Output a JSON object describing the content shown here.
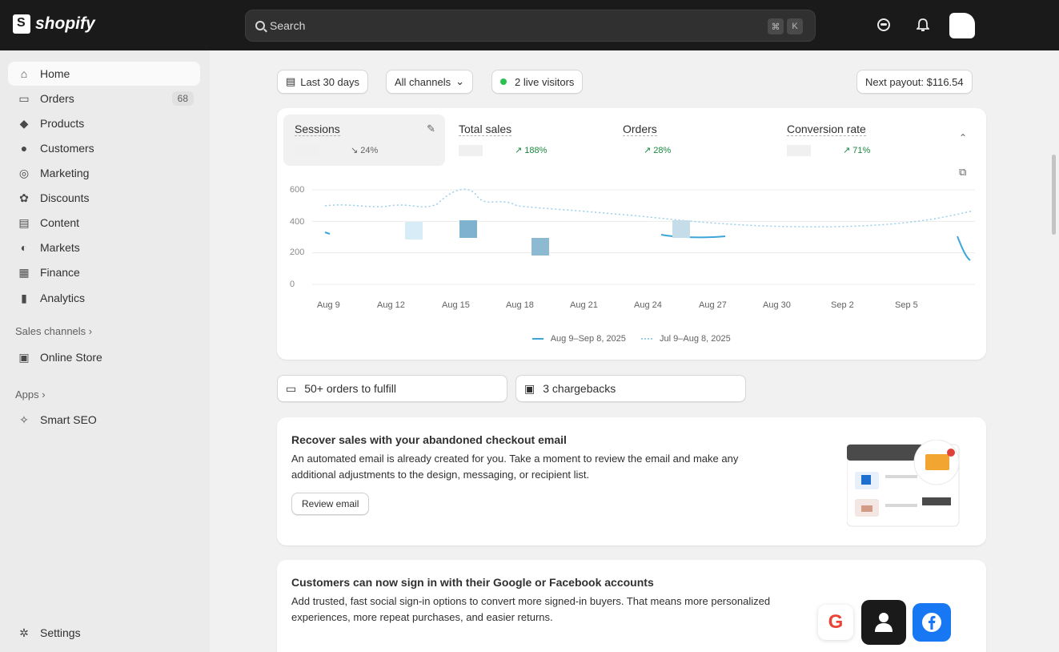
{
  "topbar": {
    "logo_text": "shopify",
    "search_placeholder": "Search",
    "shortcut_key1": "⌘",
    "shortcut_key2": "K"
  },
  "sidebar": {
    "items": [
      {
        "label": "Home",
        "icon": "home-icon"
      },
      {
        "label": "Orders",
        "icon": "inbox-icon",
        "badge": "68"
      },
      {
        "label": "Products",
        "icon": "tag-icon"
      },
      {
        "label": "Customers",
        "icon": "person-icon"
      },
      {
        "label": "Marketing",
        "icon": "target-icon"
      },
      {
        "label": "Discounts",
        "icon": "discount-icon"
      },
      {
        "label": "Content",
        "icon": "content-icon"
      },
      {
        "label": "Markets",
        "icon": "globe-icon"
      },
      {
        "label": "Finance",
        "icon": "bank-icon"
      },
      {
        "label": "Analytics",
        "icon": "bar-chart-icon"
      }
    ],
    "sales_channels_label": "Sales channels",
    "online_store_label": "Online Store",
    "apps_label": "Apps",
    "smart_seo_label": "Smart SEO",
    "settings_label": "Settings"
  },
  "filters": {
    "date_range": "Last 30 days",
    "channels": "All channels",
    "live_visitors": "2 live visitors",
    "next_payout": "Next payout: $116.54"
  },
  "metrics": [
    {
      "label": "Sessions",
      "change": "↘ 24%"
    },
    {
      "label": "Total sales",
      "change": "↗ 188%"
    },
    {
      "label": "Orders",
      "change": "↗ 28%"
    },
    {
      "label": "Conversion rate",
      "change": "↗ 71%"
    }
  ],
  "chart_data": {
    "type": "line",
    "yticks": [
      "600",
      "400",
      "200",
      "0"
    ],
    "ylim": [
      0,
      600
    ],
    "x_tick_labels": [
      "Aug 9",
      "Aug 12",
      "Aug 15",
      "Aug 18",
      "Aug 21",
      "Aug 24",
      "Aug 27",
      "Aug 30",
      "Sep 2",
      "Sep 5"
    ],
    "series": [
      {
        "name": "Aug 9–Sep 8, 2025",
        "color": "#3ca6d9",
        "style": "solid"
      },
      {
        "name": "Jul 9–Aug 8, 2025",
        "color": "#9ad0ea",
        "style": "dotted"
      }
    ]
  },
  "tasks": {
    "orders_to_fulfill": "50+ orders to fulfill",
    "chargebacks": "3 chargebacks"
  },
  "promo1": {
    "title": "Recover sales with your abandoned checkout email",
    "body": "An automated email is already created for you. Take a moment to review the email and make any additional adjustments to the design, messaging, or recipient list.",
    "button": "Review email"
  },
  "promo2": {
    "title": "Customers can now sign in with their Google or Facebook accounts",
    "body": "Add trusted, fast social sign-in options to convert more signed-in buyers. That means more personalized experiences, more repeat purchases, and easier returns."
  }
}
